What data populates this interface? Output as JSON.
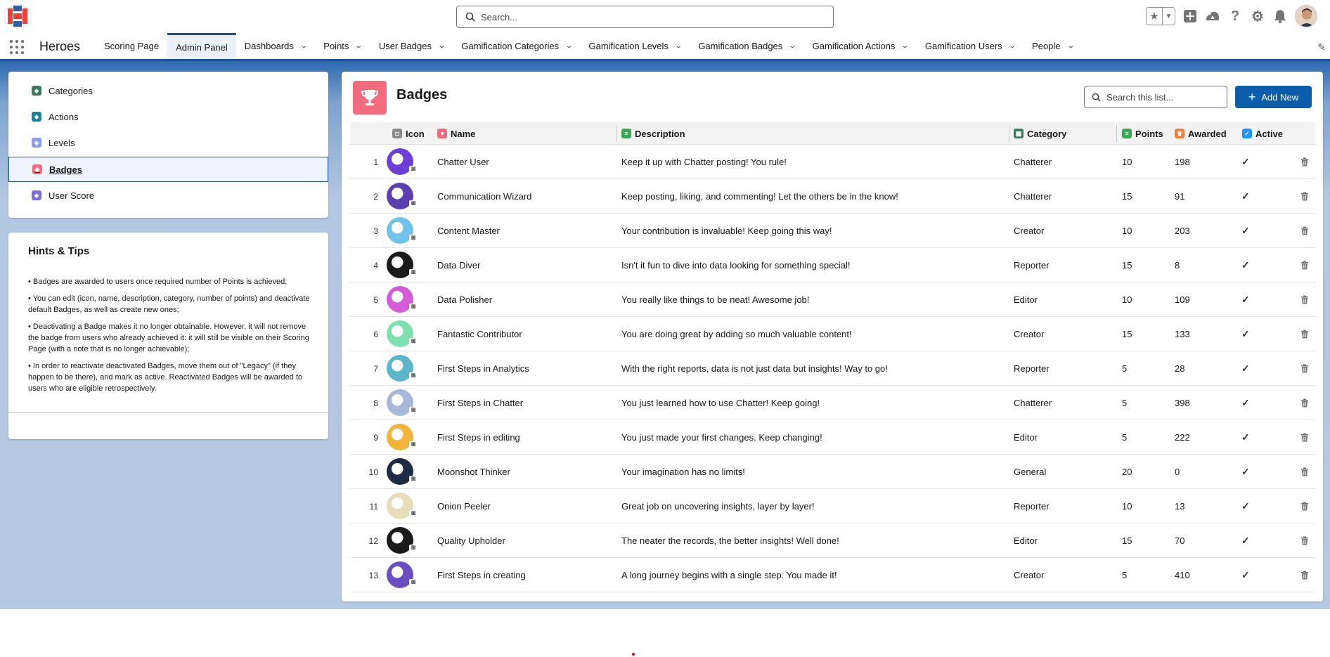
{
  "header": {
    "search_placeholder": "Search...",
    "icons": [
      "favorites-star-icon",
      "favorites-dropdown-icon",
      "add-icon",
      "trailhead-icon",
      "help-icon",
      "setup-gear-icon",
      "notifications-bell-icon"
    ]
  },
  "nav": {
    "app_name": "Heroes",
    "tabs": [
      {
        "label": "Scoring Page",
        "dropdown": false,
        "active": false
      },
      {
        "label": "Admin Panel",
        "dropdown": false,
        "active": true
      },
      {
        "label": "Dashboards",
        "dropdown": true,
        "active": false
      },
      {
        "label": "Points",
        "dropdown": true,
        "active": false
      },
      {
        "label": "User Badges",
        "dropdown": true,
        "active": false
      },
      {
        "label": "Gamification Categories",
        "dropdown": true,
        "active": false
      },
      {
        "label": "Gamification Levels",
        "dropdown": true,
        "active": false
      },
      {
        "label": "Gamification Badges",
        "dropdown": true,
        "active": false
      },
      {
        "label": "Gamification Actions",
        "dropdown": true,
        "active": false
      },
      {
        "label": "Gamification Users",
        "dropdown": true,
        "active": false
      },
      {
        "label": "People",
        "dropdown": true,
        "active": false
      }
    ]
  },
  "sidebar": {
    "items": [
      {
        "label": "Categories",
        "icon": "categories-icon",
        "color": "#3a7a5a",
        "active": false
      },
      {
        "label": "Actions",
        "icon": "actions-icon",
        "color": "#1d7f9c",
        "active": false
      },
      {
        "label": "Levels",
        "icon": "levels-icon",
        "color": "#8b9cf0",
        "active": false
      },
      {
        "label": "Badges",
        "icon": "badges-icon",
        "color": "#f16c7f",
        "active": true
      },
      {
        "label": "User Score",
        "icon": "user-score-icon",
        "color": "#7a6ee0",
        "active": false
      }
    ]
  },
  "hints": {
    "title": "Hints & Tips",
    "items": [
      "• Badges are awarded to users once required number of Points is achieved;",
      "• You can edit (icon, name, description, category, number of points) and deactivate default Badges, as well as create new ones;",
      "• Deactivating a Badge makes it no longer obtainable. However, it will not remove the badge from users who already achieved it: it will still be visible on their Scoring Page (with a note that is no longer achievable);",
      "• In order to reactivate deactivated Badges, move them out of \"Legacy\" (if they happen to be there), and mark as active. Reactivated Badges will be awarded to users who are eligible retrospectively."
    ]
  },
  "main": {
    "title": "Badges",
    "search_placeholder": "Search this list...",
    "add_button": "Add New",
    "columns": {
      "icon": "Icon",
      "name": "Name",
      "description": "Description",
      "category": "Category",
      "points": "Points",
      "awarded": "Awarded",
      "active": "Active"
    },
    "colors": {
      "accent": "#0b5cab",
      "badge_header": "#f16c7f"
    },
    "rows": [
      {
        "num": "1",
        "name": "Chatter User",
        "description": "Keep it up with Chatter posting! You rule!",
        "category": "Chatterer",
        "points": "10",
        "awarded": "198",
        "active": true,
        "icon_color": "#6d3fd6"
      },
      {
        "num": "2",
        "name": "Communication Wizard",
        "description": "Keep posting, liking, and commenting! Let the others be in the know!",
        "category": "Chatterer",
        "points": "15",
        "awarded": "91",
        "active": true,
        "icon_color": "#5b3fae"
      },
      {
        "num": "3",
        "name": "Content Master",
        "description": "Your contribution is invaluable! Keep going this way!",
        "category": "Creator",
        "points": "10",
        "awarded": "203",
        "active": true,
        "icon_color": "#6fc3e8"
      },
      {
        "num": "4",
        "name": "Data Diver",
        "description": "Isn't it fun to dive into data looking for something special!",
        "category": "Reporter",
        "points": "15",
        "awarded": "8",
        "active": true,
        "icon_color": "#1a1a1a"
      },
      {
        "num": "5",
        "name": "Data Polisher",
        "description": "You really like things to be neat! Awesome job!",
        "category": "Editor",
        "points": "10",
        "awarded": "109",
        "active": true,
        "icon_color": "#d65bd8"
      },
      {
        "num": "6",
        "name": "Fantastic Contributor",
        "description": "You are doing great by adding so much valuable content!",
        "category": "Creator",
        "points": "15",
        "awarded": "133",
        "active": true,
        "icon_color": "#7ee0b0"
      },
      {
        "num": "7",
        "name": "First Steps in Analytics",
        "description": "With the right reports, data is not just data but insights! Way to go!",
        "category": "Reporter",
        "points": "5",
        "awarded": "28",
        "active": true,
        "icon_color": "#5ab6c8"
      },
      {
        "num": "8",
        "name": "First Steps in Chatter",
        "description": "You just learned how to use Chatter! Keep going!",
        "category": "Chatterer",
        "points": "5",
        "awarded": "398",
        "active": true,
        "icon_color": "#a8b8d8"
      },
      {
        "num": "9",
        "name": "First Steps in editing",
        "description": "You just made your first changes. Keep changing!",
        "category": "Editor",
        "points": "5",
        "awarded": "222",
        "active": true,
        "icon_color": "#f0b53a"
      },
      {
        "num": "10",
        "name": "Moonshot Thinker",
        "description": "Your imagination has no limits!",
        "category": "General",
        "points": "20",
        "awarded": "0",
        "active": true,
        "icon_color": "#1f2a44"
      },
      {
        "num": "11",
        "name": "Onion Peeler",
        "description": "Great job on uncovering insights, layer by layer!",
        "category": "Reporter",
        "points": "10",
        "awarded": "13",
        "active": true,
        "icon_color": "#e9dcb8"
      },
      {
        "num": "12",
        "name": "Quality Upholder",
        "description": "The neater the records, the better insights! Well done!",
        "category": "Editor",
        "points": "15",
        "awarded": "70",
        "active": true,
        "icon_color": "#1a1a1a"
      },
      {
        "num": "13",
        "name": "First Steps in creating",
        "description": "A long journey begins with a single step. You made it!",
        "category": "Creator",
        "points": "5",
        "awarded": "410",
        "active": true,
        "icon_color": "#6a4fc0"
      }
    ]
  }
}
